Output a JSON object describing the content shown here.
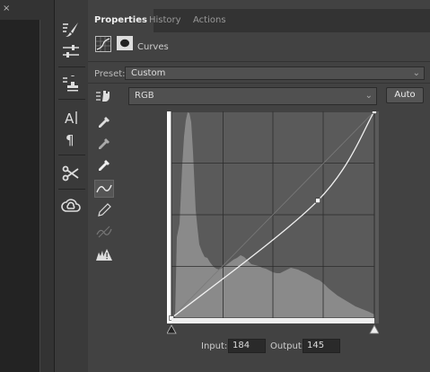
{
  "left_panel": {
    "close_glyph": "×"
  },
  "collapse_glyph": "«",
  "tools_strip": [
    "brush-presets-icon",
    "sliders-icon",
    "clone-stamp-icon",
    "character-icon",
    "paragraph-icon",
    "scissors-icon",
    "creative-cloud-icon"
  ],
  "tabs": {
    "properties": "Properties",
    "history": "History",
    "actions": "Actions"
  },
  "adjustment": {
    "title": "Curves"
  },
  "preset": {
    "label": "Preset:",
    "value": "Custom"
  },
  "channel": {
    "value": "RGB"
  },
  "auto_label": "Auto",
  "input": {
    "label": "Input:",
    "value": "184"
  },
  "output": {
    "label": "Output:",
    "value": "145"
  },
  "curve": {
    "range": [
      0,
      255
    ],
    "points": [
      [
        0,
        0
      ],
      [
        184,
        145
      ],
      [
        255,
        255
      ]
    ]
  },
  "colors": {
    "panel": "#424242",
    "tab_bar": "#333333",
    "graph_bg": "#5a5a5a",
    "histogram": "#8a8a8a"
  }
}
